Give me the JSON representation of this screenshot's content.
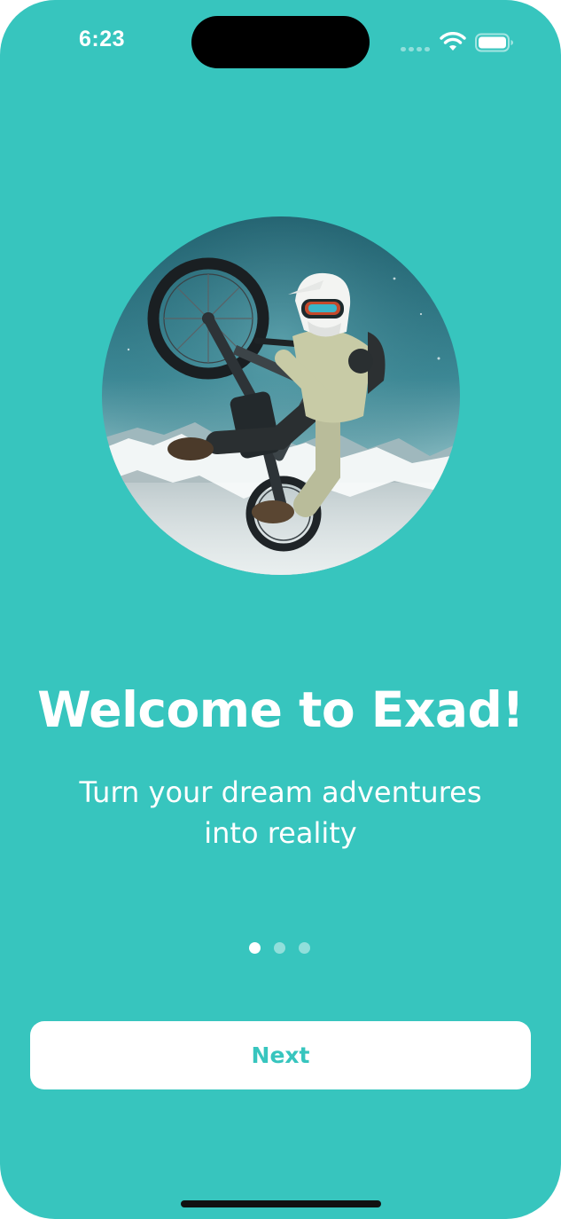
{
  "status_bar": {
    "time": "6:23",
    "icons": [
      "cellular-signal-icon",
      "wifi-icon",
      "battery-icon"
    ]
  },
  "hero": {
    "image": "mountain-biker-jumping-over-snowy-mountains"
  },
  "onboarding": {
    "title": "Welcome to Exad!",
    "subtitle_line1": "Turn your dream adventures",
    "subtitle_line2": "into reality",
    "page_count": 3,
    "current_page": 1
  },
  "actions": {
    "next_label": "Next"
  },
  "colors": {
    "background": "#37c5be",
    "button_background": "#ffffff",
    "button_text": "#37c5be",
    "text": "#ffffff"
  }
}
